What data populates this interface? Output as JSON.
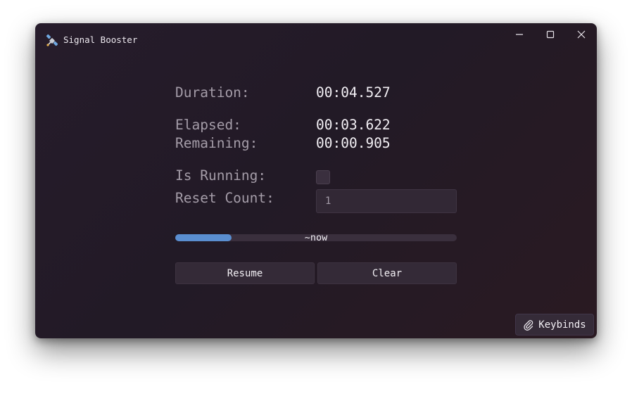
{
  "window": {
    "title": "Signal Booster",
    "app_icon": "satellite-icon",
    "controls": {
      "minimize_icon": "minimize-icon",
      "maximize_icon": "maximize-icon",
      "close_icon": "close-icon"
    }
  },
  "stats": {
    "duration_label": "Duration:",
    "duration_value": "00:04.527",
    "elapsed_label": "Elapsed:",
    "elapsed_value": "00:03.622",
    "remaining_label": "Remaining:",
    "remaining_value": "00:00.905"
  },
  "state": {
    "is_running_label": "Is Running:",
    "is_running": false,
    "reset_count_label": "Reset Count:",
    "reset_count_value": "1"
  },
  "progress": {
    "fraction": 0.2,
    "text": "~now",
    "color": "#5a8ed0"
  },
  "actions": {
    "resume_label": "Resume",
    "clear_label": "Clear"
  },
  "keybinds": {
    "label": "Keybinds",
    "icon": "paperclip-icon"
  }
}
